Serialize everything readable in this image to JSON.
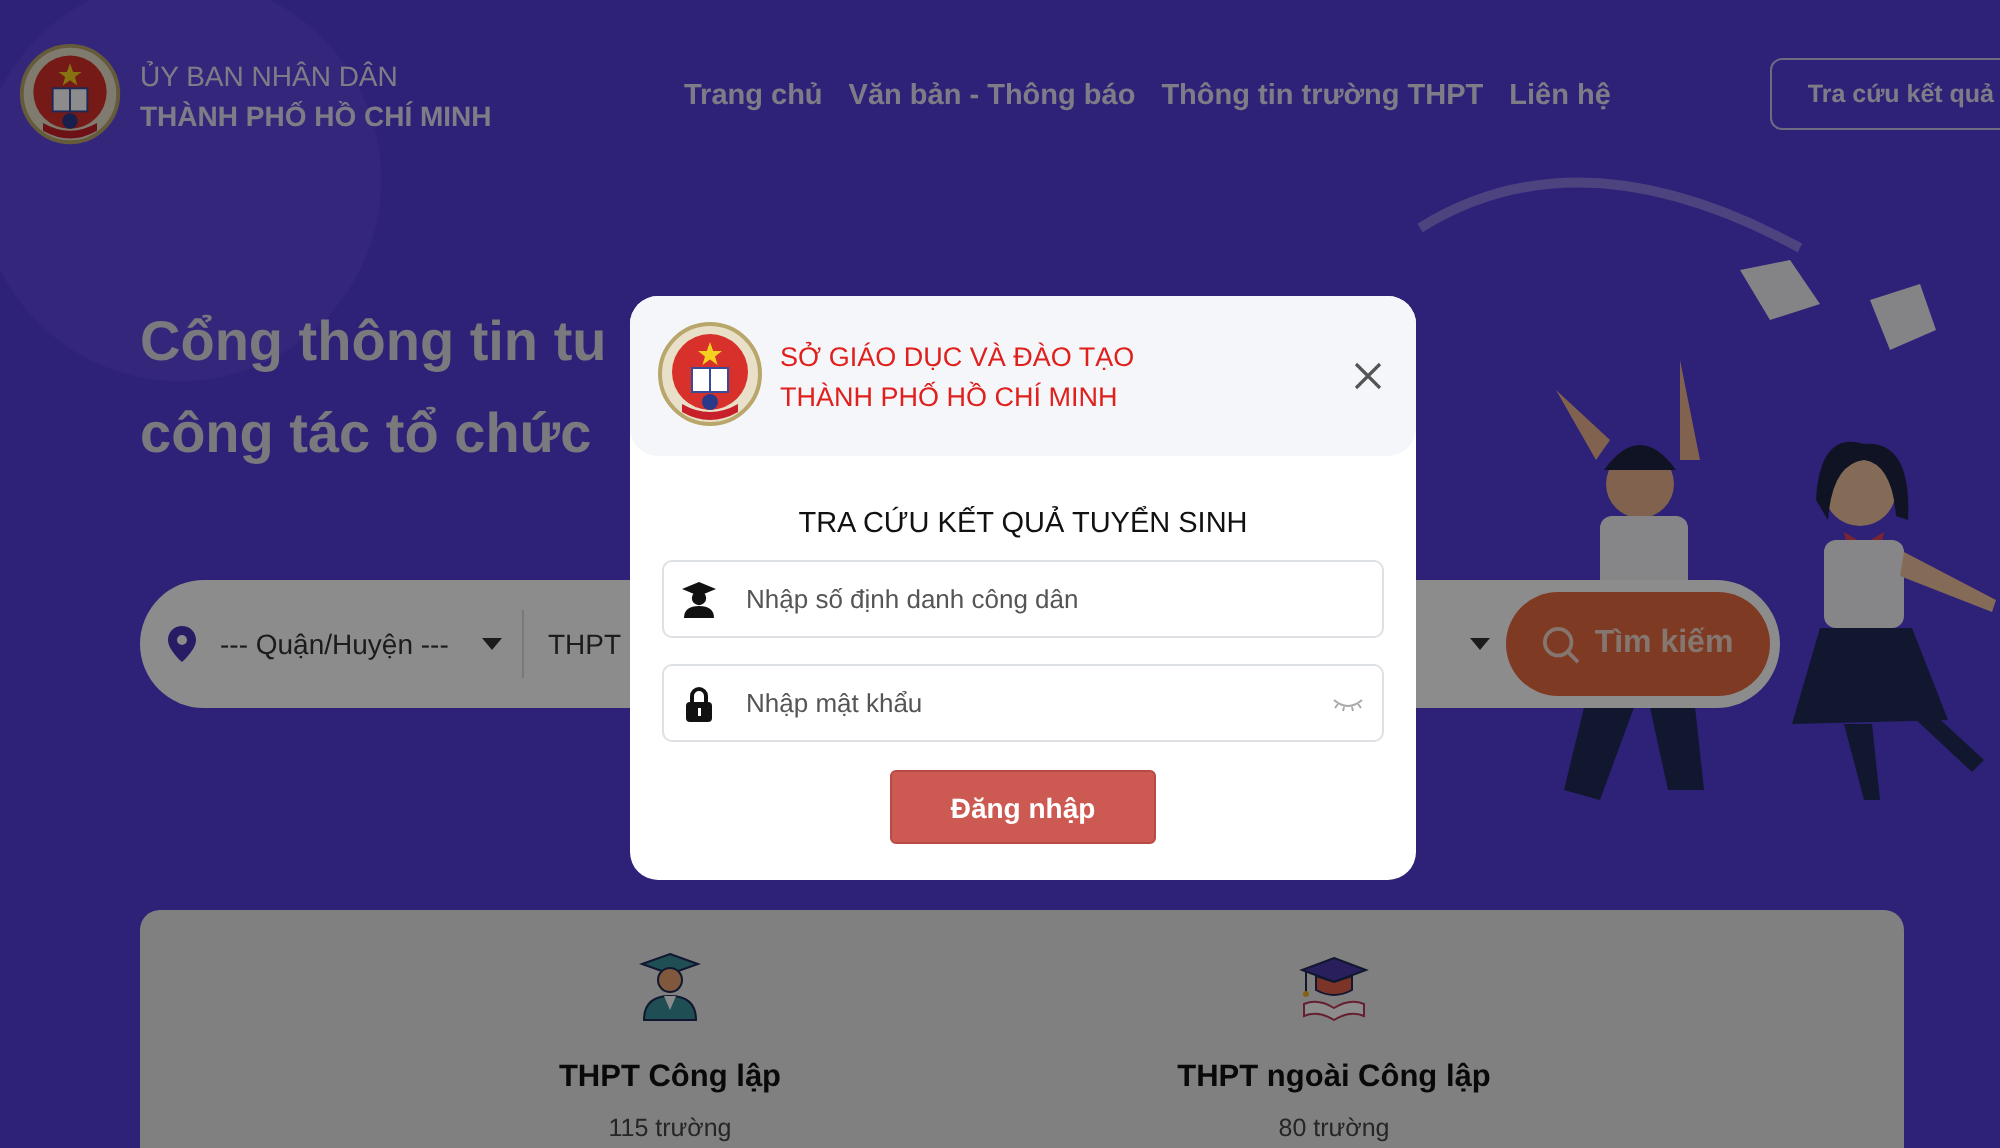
{
  "header": {
    "org_line1": "ỦY BAN NHÂN DÂN",
    "org_line2": "THÀNH PHỐ HỒ CHÍ MINH",
    "nav": [
      {
        "label": "Trang chủ"
      },
      {
        "label": "Văn bản - Thông báo"
      },
      {
        "label": "Thông tin trường THPT"
      },
      {
        "label": "Liên hệ"
      }
    ],
    "result_button": "Tra cứu kết quả"
  },
  "hero": {
    "title_lines": [
      "Cổng thông tin tu",
      "công tác tổ chức"
    ],
    "search": {
      "district": "--- Quận/Huyện ---",
      "level": "THPT",
      "button": "Tìm kiếm"
    }
  },
  "stats": [
    {
      "kind": "public",
      "title": "THPT Công lập",
      "count": "115 trường"
    },
    {
      "kind": "private",
      "title": "THPT ngoài Công lập",
      "count": "80 trường"
    }
  ],
  "modal": {
    "agency_lines": [
      "SỞ GIÁO DỤC VÀ ĐÀO TẠO",
      "THÀNH PHỐ HỒ CHÍ MINH"
    ],
    "title": "TRA CỨU KẾT QUẢ TUYỂN SINH",
    "fields": [
      {
        "kind": "id",
        "placeholder": "Nhập số định danh công dân"
      },
      {
        "kind": "password",
        "placeholder": "Nhập mật khẩu"
      }
    ],
    "submit": "Đăng nhập"
  }
}
